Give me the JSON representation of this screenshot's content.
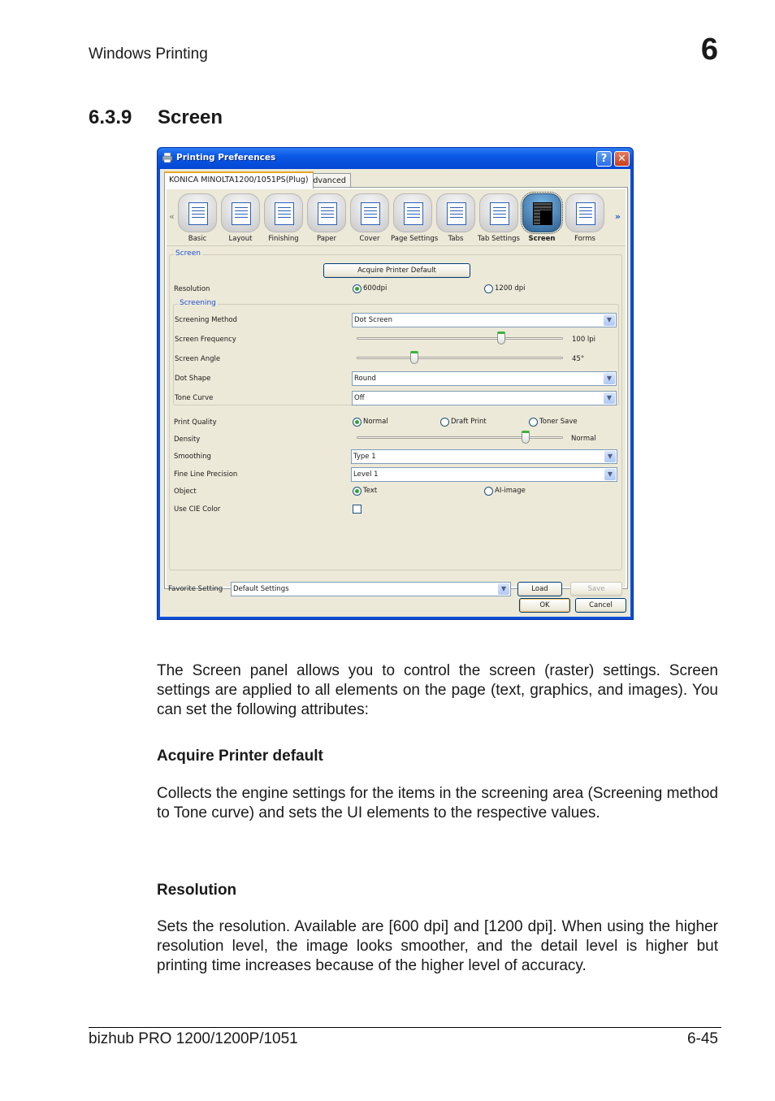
{
  "page": {
    "running_head": "Windows Printing",
    "chapter_number": "6",
    "section_number": "6.3.9",
    "section_title": "Screen",
    "intro": "The Screen panel allows you to control the screen (raster) settings. Screen settings are applied to all elements on the page (text, graphics, and images). You can set the following attributes:",
    "subsections": [
      {
        "heading": "Acquire Printer default",
        "text": "Collects the engine settings for the items in the screening area (Screening method to Tone curve) and sets the UI elements to the respective values."
      },
      {
        "heading": "Resolution",
        "text": "Sets the resolution. Available are [600 dpi] and [1200 dpi]. When using the higher resolution level, the image looks smoother, and the detail level is higher but printing time increases because of the higher level of accuracy."
      }
    ],
    "footer_left": "bizhub PRO 1200/1200P/1051",
    "footer_right": "6-45"
  },
  "dialog": {
    "title": "Printing Preferences",
    "help_button": "?",
    "close_button": "✕",
    "tabs": [
      {
        "label": "KONICA MINOLTA1200/1051PS(Plug)",
        "active": true
      },
      {
        "label": "Advanced",
        "active": false
      }
    ],
    "nav_prev": "«",
    "nav_next": "»",
    "icon_tabs": [
      {
        "label": "Basic",
        "icon": "basic-icon"
      },
      {
        "label": "Layout",
        "icon": "layout-icon"
      },
      {
        "label": "Finishing",
        "icon": "finishing-icon"
      },
      {
        "label": "Paper",
        "icon": "paper-icon"
      },
      {
        "label": "Cover",
        "icon": "cover-icon"
      },
      {
        "label": "Page Settings",
        "icon": "page-settings-icon"
      },
      {
        "label": "Tabs",
        "icon": "tabs-icon"
      },
      {
        "label": "Tab Settings",
        "icon": "tab-settings-icon"
      },
      {
        "label": "Screen",
        "icon": "screen-icon",
        "selected": true
      },
      {
        "label": "Forms",
        "icon": "forms-icon"
      }
    ],
    "screen_group": {
      "legend": "Screen",
      "acquire_button": "Acquire Printer Default",
      "resolution": {
        "label": "Resolution",
        "options": [
          {
            "label": "600dpi",
            "checked": true
          },
          {
            "label": "1200 dpi",
            "checked": false
          }
        ]
      },
      "screening_group": {
        "legend": "Screening",
        "screening_method": {
          "label": "Screening Method",
          "value": "Dot Screen"
        },
        "screen_frequency": {
          "label": "Screen Frequency",
          "value_text": "100 lpi",
          "position_pct": 70
        },
        "screen_angle": {
          "label": "Screen Angle",
          "value_text": "45°",
          "position_pct": 28
        },
        "dot_shape": {
          "label": "Dot Shape",
          "value": "Round"
        },
        "tone_curve": {
          "label": "Tone Curve",
          "value": "Off"
        }
      },
      "print_quality": {
        "label": "Print Quality",
        "options": [
          {
            "label": "Normal",
            "checked": true
          },
          {
            "label": "Draft Print",
            "checked": false
          },
          {
            "label": "Toner Save",
            "checked": false
          }
        ]
      },
      "density": {
        "label": "Density",
        "value_text": "Normal",
        "position_pct": 82
      },
      "smoothing": {
        "label": "Smoothing",
        "value": "Type 1"
      },
      "fine_line_precision": {
        "label": "Fine Line Precision",
        "value": "Level 1"
      },
      "object": {
        "label": "Object",
        "options": [
          {
            "label": "Text",
            "checked": true
          },
          {
            "label": "AI-image",
            "checked": false
          }
        ]
      },
      "use_cie_color": {
        "label": "Use CIE Color",
        "checked": false
      }
    },
    "favorite": {
      "label": "Favorite Setting",
      "value": "Default Settings",
      "load_button": "Load",
      "save_button": "Save"
    },
    "ok_button": "OK",
    "cancel_button": "Cancel"
  }
}
